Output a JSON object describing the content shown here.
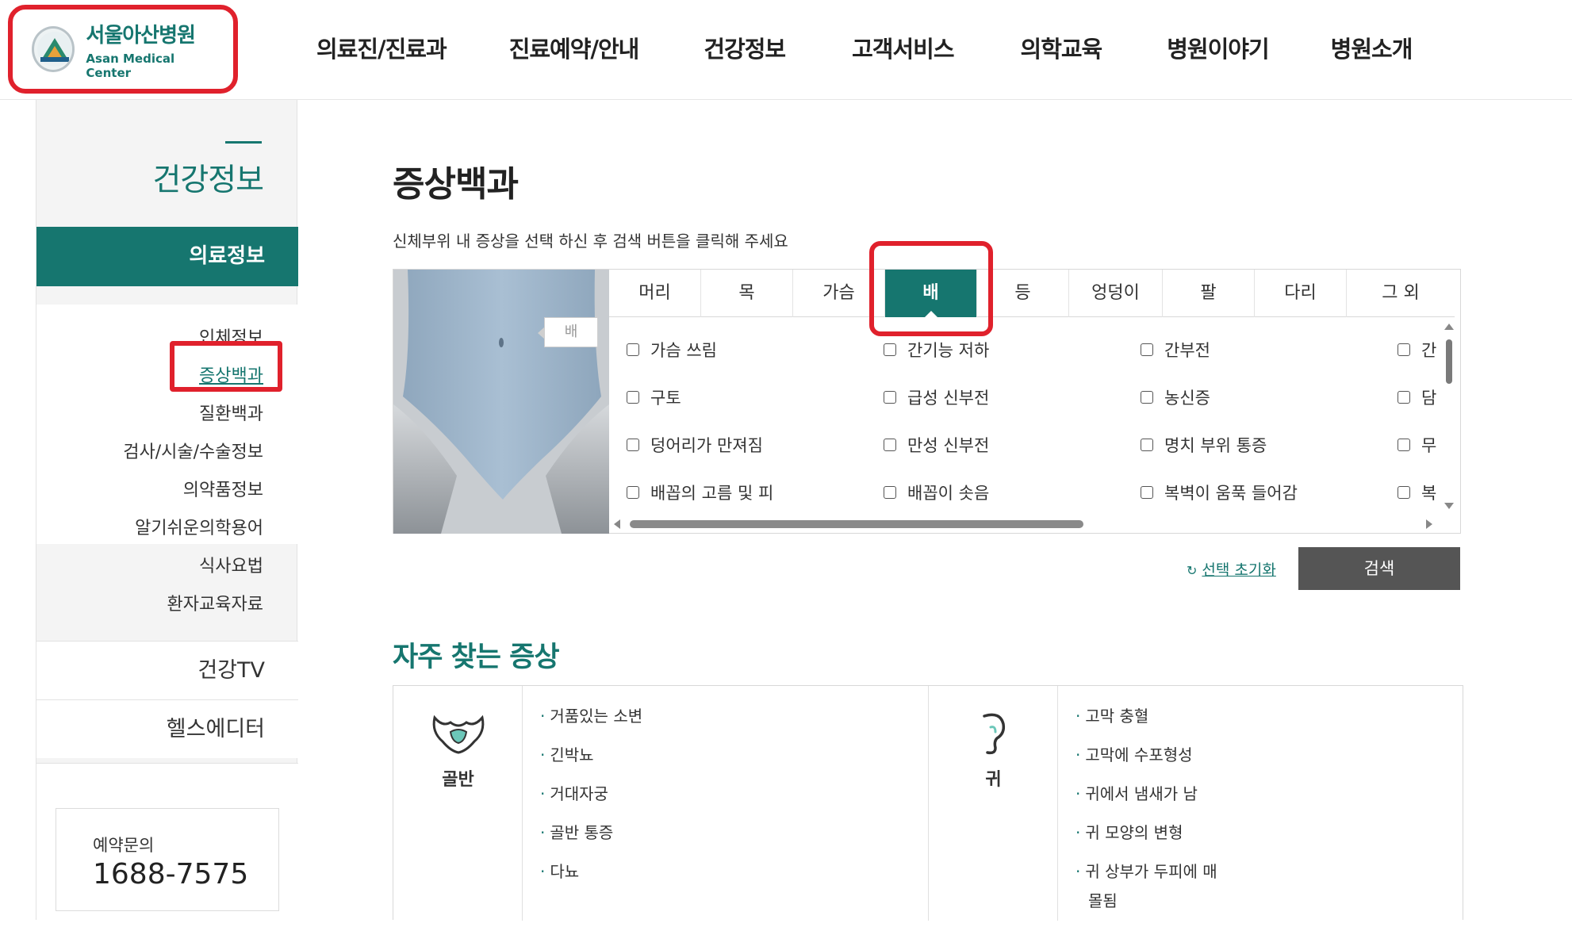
{
  "header": {
    "logo_ko": "서울아산병원",
    "logo_en": "Asan Medical Center",
    "nav": [
      "의료진/진료과",
      "진료예약/안내",
      "건강정보",
      "고객서비스",
      "의학교육",
      "병원이야기",
      "병원소개"
    ]
  },
  "sidebar": {
    "title": "건강정보",
    "active_section": "의료정보",
    "sub_items": [
      "인체정보",
      "증상백과",
      "질환백과",
      "검사/시술/수술정보",
      "의약품정보",
      "알기쉬운의학용어",
      "식사요법",
      "환자교육자료"
    ],
    "blocks": [
      "건강TV",
      "헬스에디터"
    ],
    "contact_label": "예약문의",
    "contact_phone": "1688-7575"
  },
  "main": {
    "title": "증상백과",
    "description": "신체부위 내 증상을 선택 하신 후 검색 버튼을 클릭해 주세요",
    "body_label": "배",
    "tabs": [
      "머리",
      "목",
      "가슴",
      "배",
      "등",
      "엉덩이",
      "팔",
      "다리",
      "그 외"
    ],
    "active_tab": "배",
    "symptoms": [
      [
        "가슴 쓰림",
        "간기능 저하",
        "간부전",
        "간"
      ],
      [
        "구토",
        "급성 신부전",
        "농신증",
        "담"
      ],
      [
        "덩어리가 만져짐",
        "만성 신부전",
        "명치 부위 통증",
        "무"
      ],
      [
        "배꼽의 고름 및 피",
        "배꼽이 솟음",
        "복벽이 움푹 들어감",
        "복"
      ]
    ],
    "reset_label": "선택 초기화",
    "search_label": "검색"
  },
  "frequent": {
    "title": "자주 찾는 증상",
    "groups": [
      {
        "name": "골반",
        "icon": "pelvis-icon",
        "items": [
          "거품있는 소변",
          "긴박뇨",
          "거대자궁",
          "골반 통증",
          "다뇨"
        ]
      },
      {
        "name": "귀",
        "icon": "ear-icon",
        "items": [
          "고막 충혈",
          "고막에 수포형성",
          "귀에서 냄새가 남",
          "귀 모양의 변형",
          "귀 상부가 두피에 매",
          "몰됨"
        ]
      }
    ]
  },
  "colors": {
    "accent": "#16766f",
    "highlight": "#e0212c",
    "button": "#555555"
  }
}
